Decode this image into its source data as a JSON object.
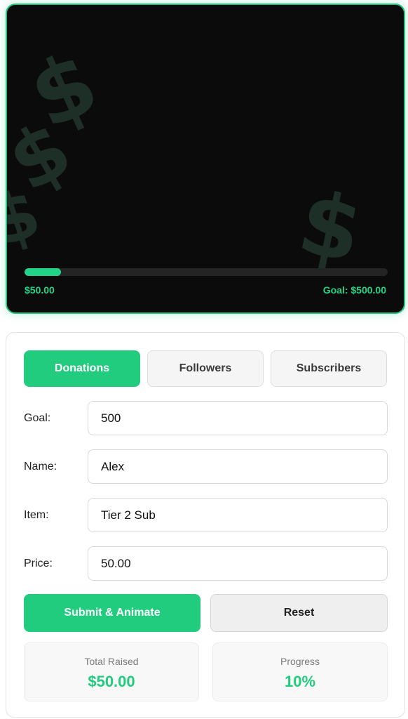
{
  "preview": {
    "current_amount": "$50.00",
    "goal_text": "Goal: $500.00",
    "progress_fraction": 0.1,
    "background_symbol": "$",
    "accent_color": "#22d488"
  },
  "tabs": [
    {
      "label": "Donations",
      "active": true
    },
    {
      "label": "Followers",
      "active": false
    },
    {
      "label": "Subscribers",
      "active": false
    }
  ],
  "form": {
    "goal": {
      "label": "Goal:",
      "value": "500"
    },
    "name": {
      "label": "Name:",
      "value": "Alex"
    },
    "item": {
      "label": "Item:",
      "value": "Tier 2 Sub"
    },
    "price": {
      "label": "Price:",
      "value": "50.00"
    }
  },
  "buttons": {
    "submit_label": "Submit & Animate",
    "reset_label": "Reset"
  },
  "stats": {
    "total_raised": {
      "title": "Total Raised",
      "value": "$50.00"
    },
    "progress": {
      "title": "Progress",
      "value": "10%"
    }
  }
}
